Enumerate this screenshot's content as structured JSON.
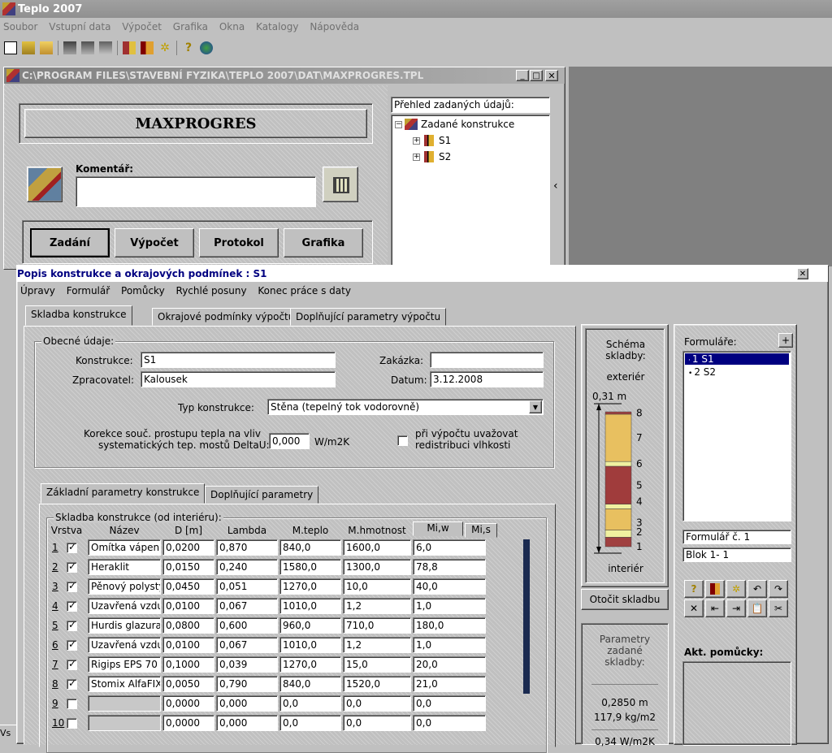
{
  "app": {
    "title": "Teplo 2007",
    "menu": [
      "Soubor",
      "Vstupní data",
      "Výpočet",
      "Grafika",
      "Okna",
      "Katalogy",
      "Nápověda"
    ]
  },
  "file_window": {
    "title": "C:\\PROGRAM FILES\\STAVEBNÍ FYZIKA\\TEPLO 2007\\DAT\\MAXPROGRES.TPL",
    "project_name": "MAXPROGRES",
    "comment_label": "Komentář:",
    "comment_value": "",
    "buttons": [
      "Zadání",
      "Výpočet",
      "Protokol",
      "Grafika"
    ],
    "tree_header": "Přehled zadaných údajů:",
    "tree_root": "Zadané konstrukce",
    "tree_items": [
      "S1",
      "S2"
    ],
    "collapse_glyph": "‹"
  },
  "dialog": {
    "title": "Popis konstrukce a okrajových podmínek : S1",
    "menu": [
      "Úpravy",
      "Formulář",
      "Pomůcky",
      "Rychlé posuny",
      "Konec práce s daty"
    ],
    "tabs": [
      "Skladba konstrukce",
      "Okrajové podmínky výpočtu",
      "Doplňující parametry výpočtu"
    ],
    "general": {
      "group_label": "Obecné údaje:",
      "konstrukce_label": "Konstrukce:",
      "konstrukce_value": "S1",
      "zakazka_label": "Zakázka:",
      "zakazka_value": "",
      "zpracovatel_label": "Zpracovatel:",
      "zpracovatel_value": "Kalousek",
      "datum_label": "Datum:",
      "datum_value": "3.12.2008",
      "typ_label": "Typ konstrukce:",
      "typ_value": "Stěna (tepelný tok vodorovně)",
      "korekce_label_1": "Korekce souč. prostupu tepla na vliv",
      "korekce_label_2": "systematických tep. mostů DeltaU:",
      "korekce_value": "0,000",
      "korekce_unit": "W/m2K",
      "redistribuce_label_1": "při výpočtu uvažovat",
      "redistribuce_label_2": "redistribuci vlhkosti"
    },
    "subtabs": [
      "Základní parametry konstrukce",
      "Doplňující parametry"
    ],
    "layers_group_label": "Skladba konstrukce (od interiéru):",
    "columns": [
      "Vrstva",
      "Název",
      "D [m]",
      "Lambda",
      "M.teplo",
      "M.hmotnost",
      "Mi,w",
      "Mi,s"
    ],
    "rows": [
      {
        "n": "1",
        "on": true,
        "name": "Omítka vápenn",
        "d": "0,0200",
        "lambda": "0,870",
        "teplo": "840,0",
        "hmot": "1600,0",
        "mi": "6,0"
      },
      {
        "n": "2",
        "on": true,
        "name": "Heraklit",
        "d": "0,0150",
        "lambda": "0,240",
        "teplo": "1580,0",
        "hmot": "1300,0",
        "mi": "78,8"
      },
      {
        "n": "3",
        "on": true,
        "name": "Pěnový polystyr",
        "d": "0,0450",
        "lambda": "0,051",
        "teplo": "1270,0",
        "hmot": "10,0",
        "mi": "40,0"
      },
      {
        "n": "4",
        "on": true,
        "name": "Uzavřená vzdu",
        "d": "0,0100",
        "lambda": "0,067",
        "teplo": "1010,0",
        "hmot": "1,2",
        "mi": "1,0"
      },
      {
        "n": "5",
        "on": true,
        "name": "Hurdis glazura",
        "d": "0,0800",
        "lambda": "0,600",
        "teplo": "960,0",
        "hmot": "710,0",
        "mi": "180,0"
      },
      {
        "n": "6",
        "on": true,
        "name": "Uzavřená vzdu",
        "d": "0,0100",
        "lambda": "0,067",
        "teplo": "1010,0",
        "hmot": "1,2",
        "mi": "1,0"
      },
      {
        "n": "7",
        "on": true,
        "name": "Rigips EPS 70",
        "d": "0,1000",
        "lambda": "0,039",
        "teplo": "1270,0",
        "hmot": "15,0",
        "mi": "20,0"
      },
      {
        "n": "8",
        "on": true,
        "name": "Stomix AlfaFIX",
        "d": "0,0050",
        "lambda": "0,790",
        "teplo": "840,0",
        "hmot": "1520,0",
        "mi": "21,0"
      },
      {
        "n": "9",
        "on": false,
        "name": "",
        "d": "0,0000",
        "lambda": "0,000",
        "teplo": "0,0",
        "hmot": "0,0",
        "mi": "0,0"
      },
      {
        "n": "10",
        "on": false,
        "name": "",
        "d": "0,0000",
        "lambda": "0,000",
        "teplo": "0,0",
        "hmot": "0,0",
        "mi": "0,0"
      }
    ],
    "schema": {
      "title": "Schéma skladby:",
      "exterior": "exteriér",
      "interior": "interiér",
      "thickness": "0,31 m",
      "layer_numbers": [
        "8",
        "7",
        "6",
        "5",
        "4",
        "3",
        "2",
        "1"
      ],
      "rotate_button": "Otočit skladbu"
    },
    "params": {
      "title": "Parametry zadané skladby:",
      "thickness": "0,2850 m",
      "mass": "117,9 kg/m2",
      "u_value": "0,34 W/m2K"
    },
    "forms": {
      "title": "Formuláře:",
      "items": [
        "1 S1",
        "2 S2"
      ],
      "form_no": "Formulář č. 1",
      "block": "Blok 1- 1",
      "tools_label": "Akt. pomůcky:"
    }
  },
  "statusbar": {
    "text": "Vs"
  },
  "colors": {
    "layer_plaster": "#a04040",
    "layer_insulation": "#e8c060",
    "layer_air": "#f0f0a0",
    "layer_brick": "#a03c3c",
    "selection": "#000080"
  }
}
